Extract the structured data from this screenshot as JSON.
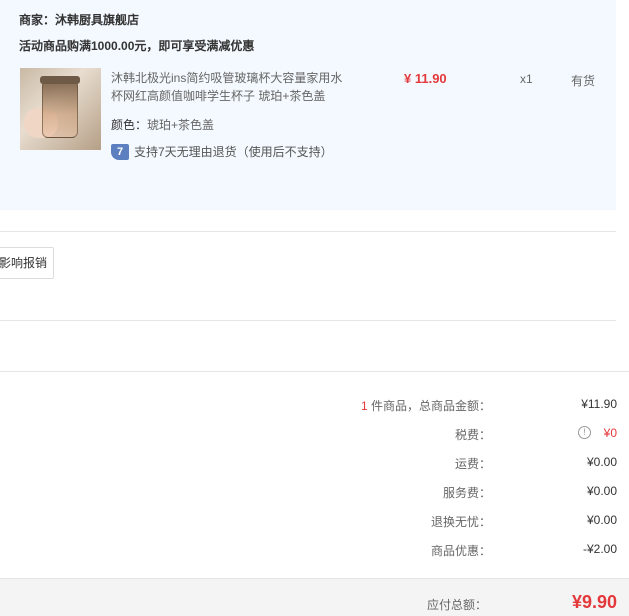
{
  "store": {
    "seller": "商家：沐韩厨具旗舰店",
    "promo": "活动商品购满1000.00元，即可享受满减优惠"
  },
  "item": {
    "title": "沐韩北极光ins简约吸管玻璃杯大容量家用水杯网红高颜值咖啡学生杯子 琥珀+茶色盖",
    "color_key": "颜色：",
    "color_value": "琥珀+茶色盖",
    "return_badge": "7",
    "return_text": "支持7天无理由退货（使用后不支持）",
    "price": "¥ 11.90",
    "qty": "x1",
    "stock": "有货"
  },
  "invoice": {
    "button_label": "影响报销"
  },
  "summary": {
    "count_num": "1",
    "count_label": " 件商品，总商品金额：",
    "goods_total": "¥11.90",
    "tax_label": "税费：",
    "tax_value": "¥0",
    "shipping_label": "运费：",
    "shipping_value": "¥0.00",
    "service_label": "服务费：",
    "service_value": "¥0.00",
    "return_label": "退换无忧：",
    "return_value": "¥0.00",
    "discount_label": "商品优惠：",
    "discount_value": "-¥2.00",
    "payable_label": "应付总额：",
    "payable_value": "¥9.90"
  },
  "colors": {
    "accent_red": "#e4393c",
    "panel_bg": "#f3f9fe",
    "badge_blue": "#5b7fbf"
  }
}
